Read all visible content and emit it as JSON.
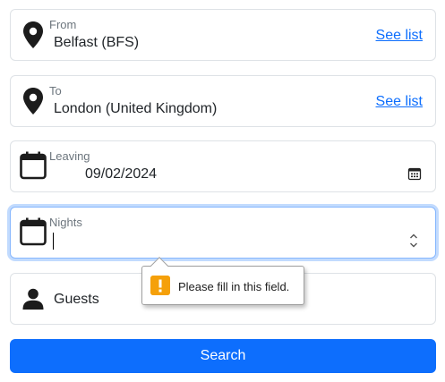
{
  "form": {
    "from": {
      "label": "From",
      "value": "Belfast (BFS)",
      "link": "See list"
    },
    "to": {
      "label": "To",
      "value": "London (United Kingdom)",
      "link": "See list"
    },
    "leaving": {
      "label": "Leaving",
      "value": "09/02/2024"
    },
    "nights": {
      "label": "Nights",
      "value": ""
    },
    "guests": {
      "placeholder": "Guests"
    },
    "search_label": "Search"
  },
  "validation": {
    "message": "Please fill in this field.",
    "color": "#f5a00a"
  },
  "colors": {
    "primary": "#0d6efd",
    "focus_ring": "#86b7fe",
    "border": "#dee2e6"
  },
  "icons": [
    "map-pin-icon",
    "calendar-icon",
    "calendar-picker-icon",
    "person-icon",
    "warning-icon"
  ]
}
